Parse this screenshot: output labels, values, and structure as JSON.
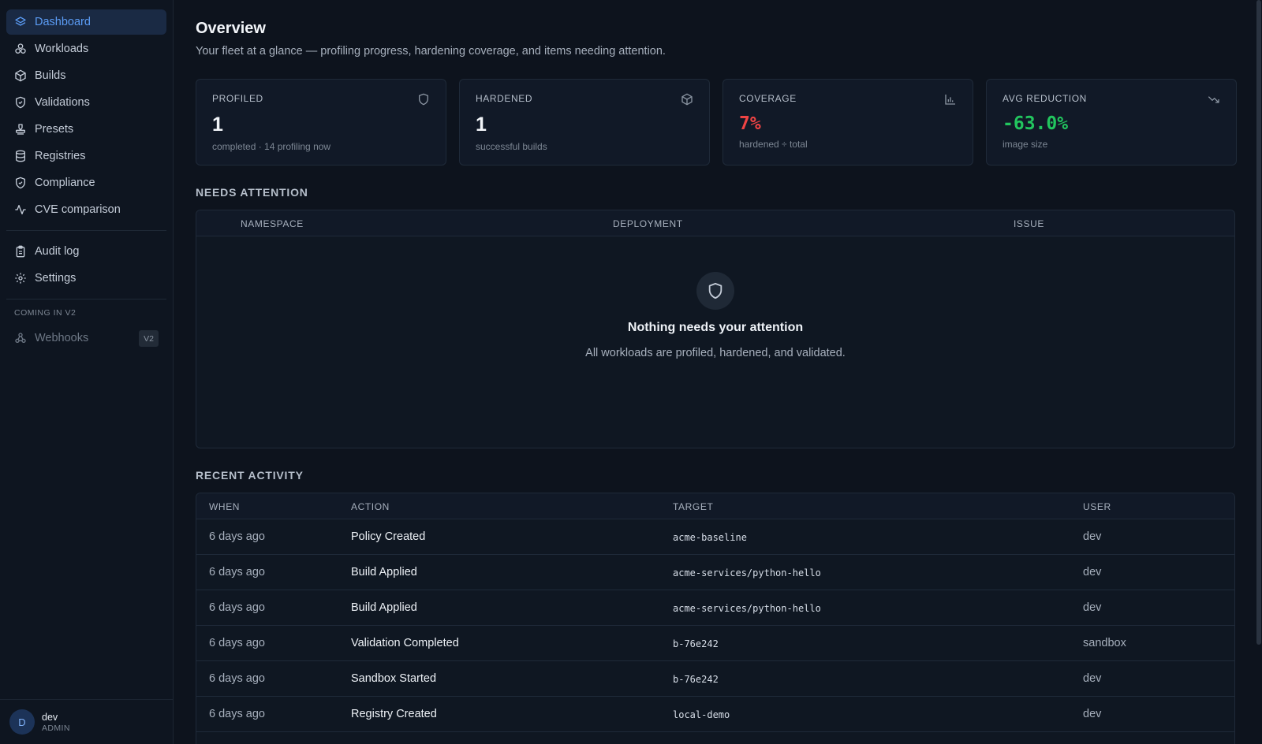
{
  "sidebar": {
    "items": [
      {
        "label": "Dashboard",
        "icon": "layers-icon"
      },
      {
        "label": "Workloads",
        "icon": "boxes-icon"
      },
      {
        "label": "Builds",
        "icon": "package-icon"
      },
      {
        "label": "Validations",
        "icon": "shield-check-icon"
      },
      {
        "label": "Presets",
        "icon": "stamp-icon"
      },
      {
        "label": "Registries",
        "icon": "database-icon"
      },
      {
        "label": "Compliance",
        "icon": "shield-check-icon"
      },
      {
        "label": "CVE comparison",
        "icon": "activity-icon"
      }
    ],
    "secondary": [
      {
        "label": "Audit log",
        "icon": "clipboard-icon"
      },
      {
        "label": "Settings",
        "icon": "gear-icon"
      }
    ],
    "section_label": "COMING IN V2",
    "coming": {
      "label": "Webhooks",
      "badge": "V2",
      "icon": "webhook-icon"
    },
    "user": {
      "initial": "D",
      "name": "dev",
      "role": "ADMIN"
    }
  },
  "header": {
    "title": "Overview",
    "subtitle": "Your fleet at a glance — profiling progress, hardening coverage, and items needing attention."
  },
  "cards": [
    {
      "label": "PROFILED",
      "value": "1",
      "sub": "completed · 14 profiling now",
      "icon": "shield-icon"
    },
    {
      "label": "HARDENED",
      "value": "1",
      "sub": "successful builds",
      "icon": "package-icon"
    },
    {
      "label": "COVERAGE",
      "value": "7%",
      "sub": "hardened ÷ total",
      "icon": "bar-chart-icon",
      "color": "#ef4444"
    },
    {
      "label": "AVG REDUCTION",
      "value": "-63.0%",
      "sub": "image size",
      "icon": "trending-down-icon",
      "color": "#22c55e"
    }
  ],
  "attention": {
    "title": "NEEDS ATTENTION",
    "columns": [
      "NAMESPACE",
      "DEPLOYMENT",
      "ISSUE"
    ],
    "empty_title": "Nothing needs your attention",
    "empty_sub": "All workloads are profiled, hardened, and validated."
  },
  "activity": {
    "title": "RECENT ACTIVITY",
    "columns": [
      "WHEN",
      "ACTION",
      "TARGET",
      "USER"
    ],
    "rows": [
      {
        "when": "6 days ago",
        "action": "Policy Created",
        "target": "acme-baseline",
        "user": "dev"
      },
      {
        "when": "6 days ago",
        "action": "Build Applied",
        "target": "acme-services/python-hello",
        "user": "dev"
      },
      {
        "when": "6 days ago",
        "action": "Build Applied",
        "target": "acme-services/python-hello",
        "user": "dev"
      },
      {
        "when": "6 days ago",
        "action": "Validation Completed",
        "target": "b-76e242",
        "user": "sandbox"
      },
      {
        "when": "6 days ago",
        "action": "Sandbox Started",
        "target": "b-76e242",
        "user": "dev"
      },
      {
        "when": "6 days ago",
        "action": "Registry Created",
        "target": "local-demo",
        "user": "dev"
      }
    ]
  }
}
